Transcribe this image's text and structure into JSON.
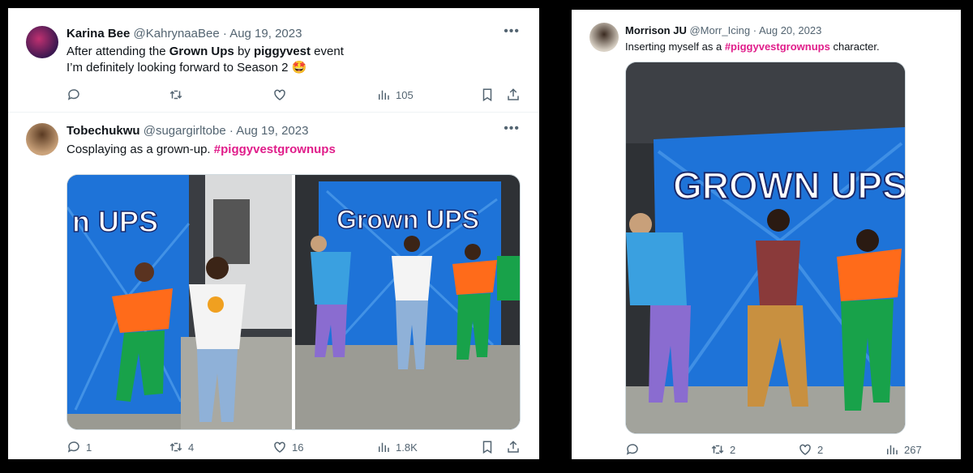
{
  "left_panel": {
    "tweet1": {
      "name": "Karina Bee",
      "handle": "@KahrynaaBee",
      "date": "Aug 19, 2023",
      "text_pre": "After attending the ",
      "text_bold1": "Grown Ups",
      "text_mid": " by ",
      "text_bold2": "piggyvest",
      "text_post": " event",
      "line2": "I’m definitely looking forward to Season 2",
      "emoji": "🤩",
      "stats": {
        "views": "105"
      }
    },
    "tweet2": {
      "name": "Tobechukwu",
      "handle": "@sugargirltobe",
      "date": "Aug 19, 2023",
      "text": "Cosplaying as a grown-up. ",
      "hashtag": "#piggyvestgrownups",
      "stats": {
        "replies": "1",
        "retweets": "4",
        "likes": "16",
        "views": "1.8K"
      },
      "banner_left": "n UPS",
      "banner_right": "Grown UPS"
    }
  },
  "right_panel": {
    "tweet": {
      "name": "Morrison JU",
      "handle": "@Morr_Icing",
      "date": "Aug 20, 2023",
      "text_pre": "Inserting myself as a ",
      "hashtag": "#piggyvestgrownups",
      "text_post": " character.",
      "banner": "GROWN UPS",
      "stats": {
        "retweets": "2",
        "likes": "2",
        "views": "267"
      }
    }
  },
  "colors": {
    "hashtag": "#e01d8a",
    "banner_blue": "#1e6fd6",
    "muted": "#536471"
  }
}
